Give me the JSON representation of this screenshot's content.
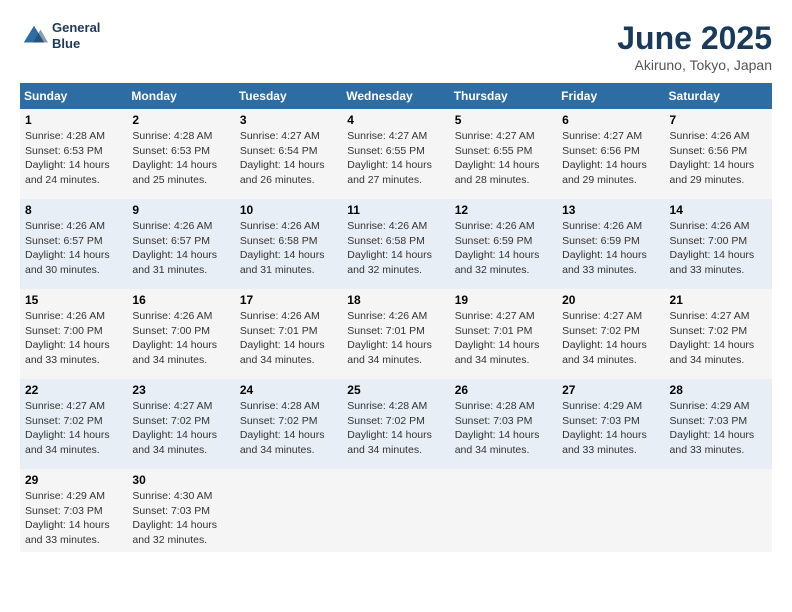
{
  "header": {
    "logo_line1": "General",
    "logo_line2": "Blue",
    "title": "June 2025",
    "subtitle": "Akiruno, Tokyo, Japan"
  },
  "days_of_week": [
    "Sunday",
    "Monday",
    "Tuesday",
    "Wednesday",
    "Thursday",
    "Friday",
    "Saturday"
  ],
  "weeks": [
    [
      {
        "day": "1",
        "info": "Sunrise: 4:28 AM\nSunset: 6:53 PM\nDaylight: 14 hours\nand 24 minutes."
      },
      {
        "day": "2",
        "info": "Sunrise: 4:28 AM\nSunset: 6:53 PM\nDaylight: 14 hours\nand 25 minutes."
      },
      {
        "day": "3",
        "info": "Sunrise: 4:27 AM\nSunset: 6:54 PM\nDaylight: 14 hours\nand 26 minutes."
      },
      {
        "day": "4",
        "info": "Sunrise: 4:27 AM\nSunset: 6:55 PM\nDaylight: 14 hours\nand 27 minutes."
      },
      {
        "day": "5",
        "info": "Sunrise: 4:27 AM\nSunset: 6:55 PM\nDaylight: 14 hours\nand 28 minutes."
      },
      {
        "day": "6",
        "info": "Sunrise: 4:27 AM\nSunset: 6:56 PM\nDaylight: 14 hours\nand 29 minutes."
      },
      {
        "day": "7",
        "info": "Sunrise: 4:26 AM\nSunset: 6:56 PM\nDaylight: 14 hours\nand 29 minutes."
      }
    ],
    [
      {
        "day": "8",
        "info": "Sunrise: 4:26 AM\nSunset: 6:57 PM\nDaylight: 14 hours\nand 30 minutes."
      },
      {
        "day": "9",
        "info": "Sunrise: 4:26 AM\nSunset: 6:57 PM\nDaylight: 14 hours\nand 31 minutes."
      },
      {
        "day": "10",
        "info": "Sunrise: 4:26 AM\nSunset: 6:58 PM\nDaylight: 14 hours\nand 31 minutes."
      },
      {
        "day": "11",
        "info": "Sunrise: 4:26 AM\nSunset: 6:58 PM\nDaylight: 14 hours\nand 32 minutes."
      },
      {
        "day": "12",
        "info": "Sunrise: 4:26 AM\nSunset: 6:59 PM\nDaylight: 14 hours\nand 32 minutes."
      },
      {
        "day": "13",
        "info": "Sunrise: 4:26 AM\nSunset: 6:59 PM\nDaylight: 14 hours\nand 33 minutes."
      },
      {
        "day": "14",
        "info": "Sunrise: 4:26 AM\nSunset: 7:00 PM\nDaylight: 14 hours\nand 33 minutes."
      }
    ],
    [
      {
        "day": "15",
        "info": "Sunrise: 4:26 AM\nSunset: 7:00 PM\nDaylight: 14 hours\nand 33 minutes."
      },
      {
        "day": "16",
        "info": "Sunrise: 4:26 AM\nSunset: 7:00 PM\nDaylight: 14 hours\nand 34 minutes."
      },
      {
        "day": "17",
        "info": "Sunrise: 4:26 AM\nSunset: 7:01 PM\nDaylight: 14 hours\nand 34 minutes."
      },
      {
        "day": "18",
        "info": "Sunrise: 4:26 AM\nSunset: 7:01 PM\nDaylight: 14 hours\nand 34 minutes."
      },
      {
        "day": "19",
        "info": "Sunrise: 4:27 AM\nSunset: 7:01 PM\nDaylight: 14 hours\nand 34 minutes."
      },
      {
        "day": "20",
        "info": "Sunrise: 4:27 AM\nSunset: 7:02 PM\nDaylight: 14 hours\nand 34 minutes."
      },
      {
        "day": "21",
        "info": "Sunrise: 4:27 AM\nSunset: 7:02 PM\nDaylight: 14 hours\nand 34 minutes."
      }
    ],
    [
      {
        "day": "22",
        "info": "Sunrise: 4:27 AM\nSunset: 7:02 PM\nDaylight: 14 hours\nand 34 minutes."
      },
      {
        "day": "23",
        "info": "Sunrise: 4:27 AM\nSunset: 7:02 PM\nDaylight: 14 hours\nand 34 minutes."
      },
      {
        "day": "24",
        "info": "Sunrise: 4:28 AM\nSunset: 7:02 PM\nDaylight: 14 hours\nand 34 minutes."
      },
      {
        "day": "25",
        "info": "Sunrise: 4:28 AM\nSunset: 7:02 PM\nDaylight: 14 hours\nand 34 minutes."
      },
      {
        "day": "26",
        "info": "Sunrise: 4:28 AM\nSunset: 7:03 PM\nDaylight: 14 hours\nand 34 minutes."
      },
      {
        "day": "27",
        "info": "Sunrise: 4:29 AM\nSunset: 7:03 PM\nDaylight: 14 hours\nand 33 minutes."
      },
      {
        "day": "28",
        "info": "Sunrise: 4:29 AM\nSunset: 7:03 PM\nDaylight: 14 hours\nand 33 minutes."
      }
    ],
    [
      {
        "day": "29",
        "info": "Sunrise: 4:29 AM\nSunset: 7:03 PM\nDaylight: 14 hours\nand 33 minutes."
      },
      {
        "day": "30",
        "info": "Sunrise: 4:30 AM\nSunset: 7:03 PM\nDaylight: 14 hours\nand 32 minutes."
      },
      {
        "day": "",
        "info": ""
      },
      {
        "day": "",
        "info": ""
      },
      {
        "day": "",
        "info": ""
      },
      {
        "day": "",
        "info": ""
      },
      {
        "day": "",
        "info": ""
      }
    ]
  ]
}
